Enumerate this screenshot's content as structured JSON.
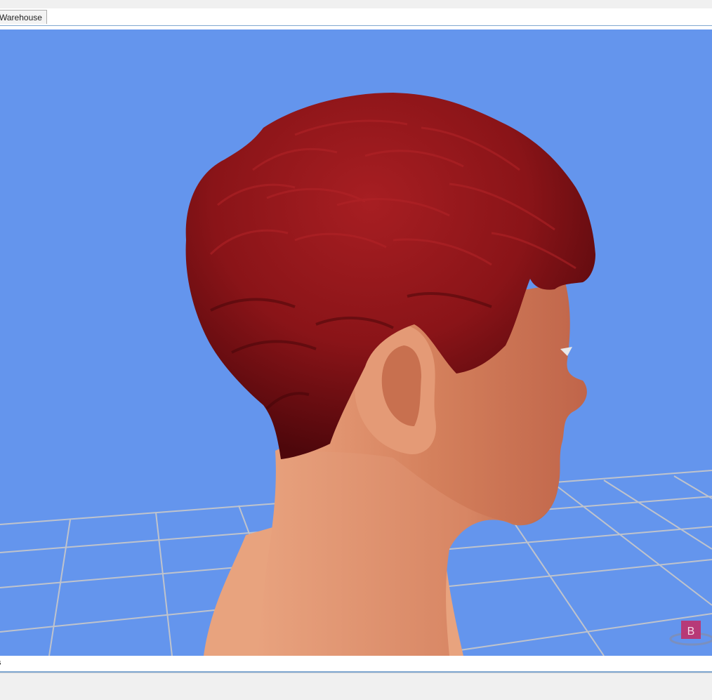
{
  "document_tab": {
    "label": "Warehouse"
  },
  "statusbar": {
    "text": "s"
  },
  "viewport": {
    "background_color": "#6495ed",
    "grid_color": "#c9c9c9",
    "hair_color": "#8a1418",
    "skin_color": "#d98a66",
    "subject": "3d-head-model",
    "badge": {
      "label": "B",
      "color": "#c0306a"
    }
  }
}
